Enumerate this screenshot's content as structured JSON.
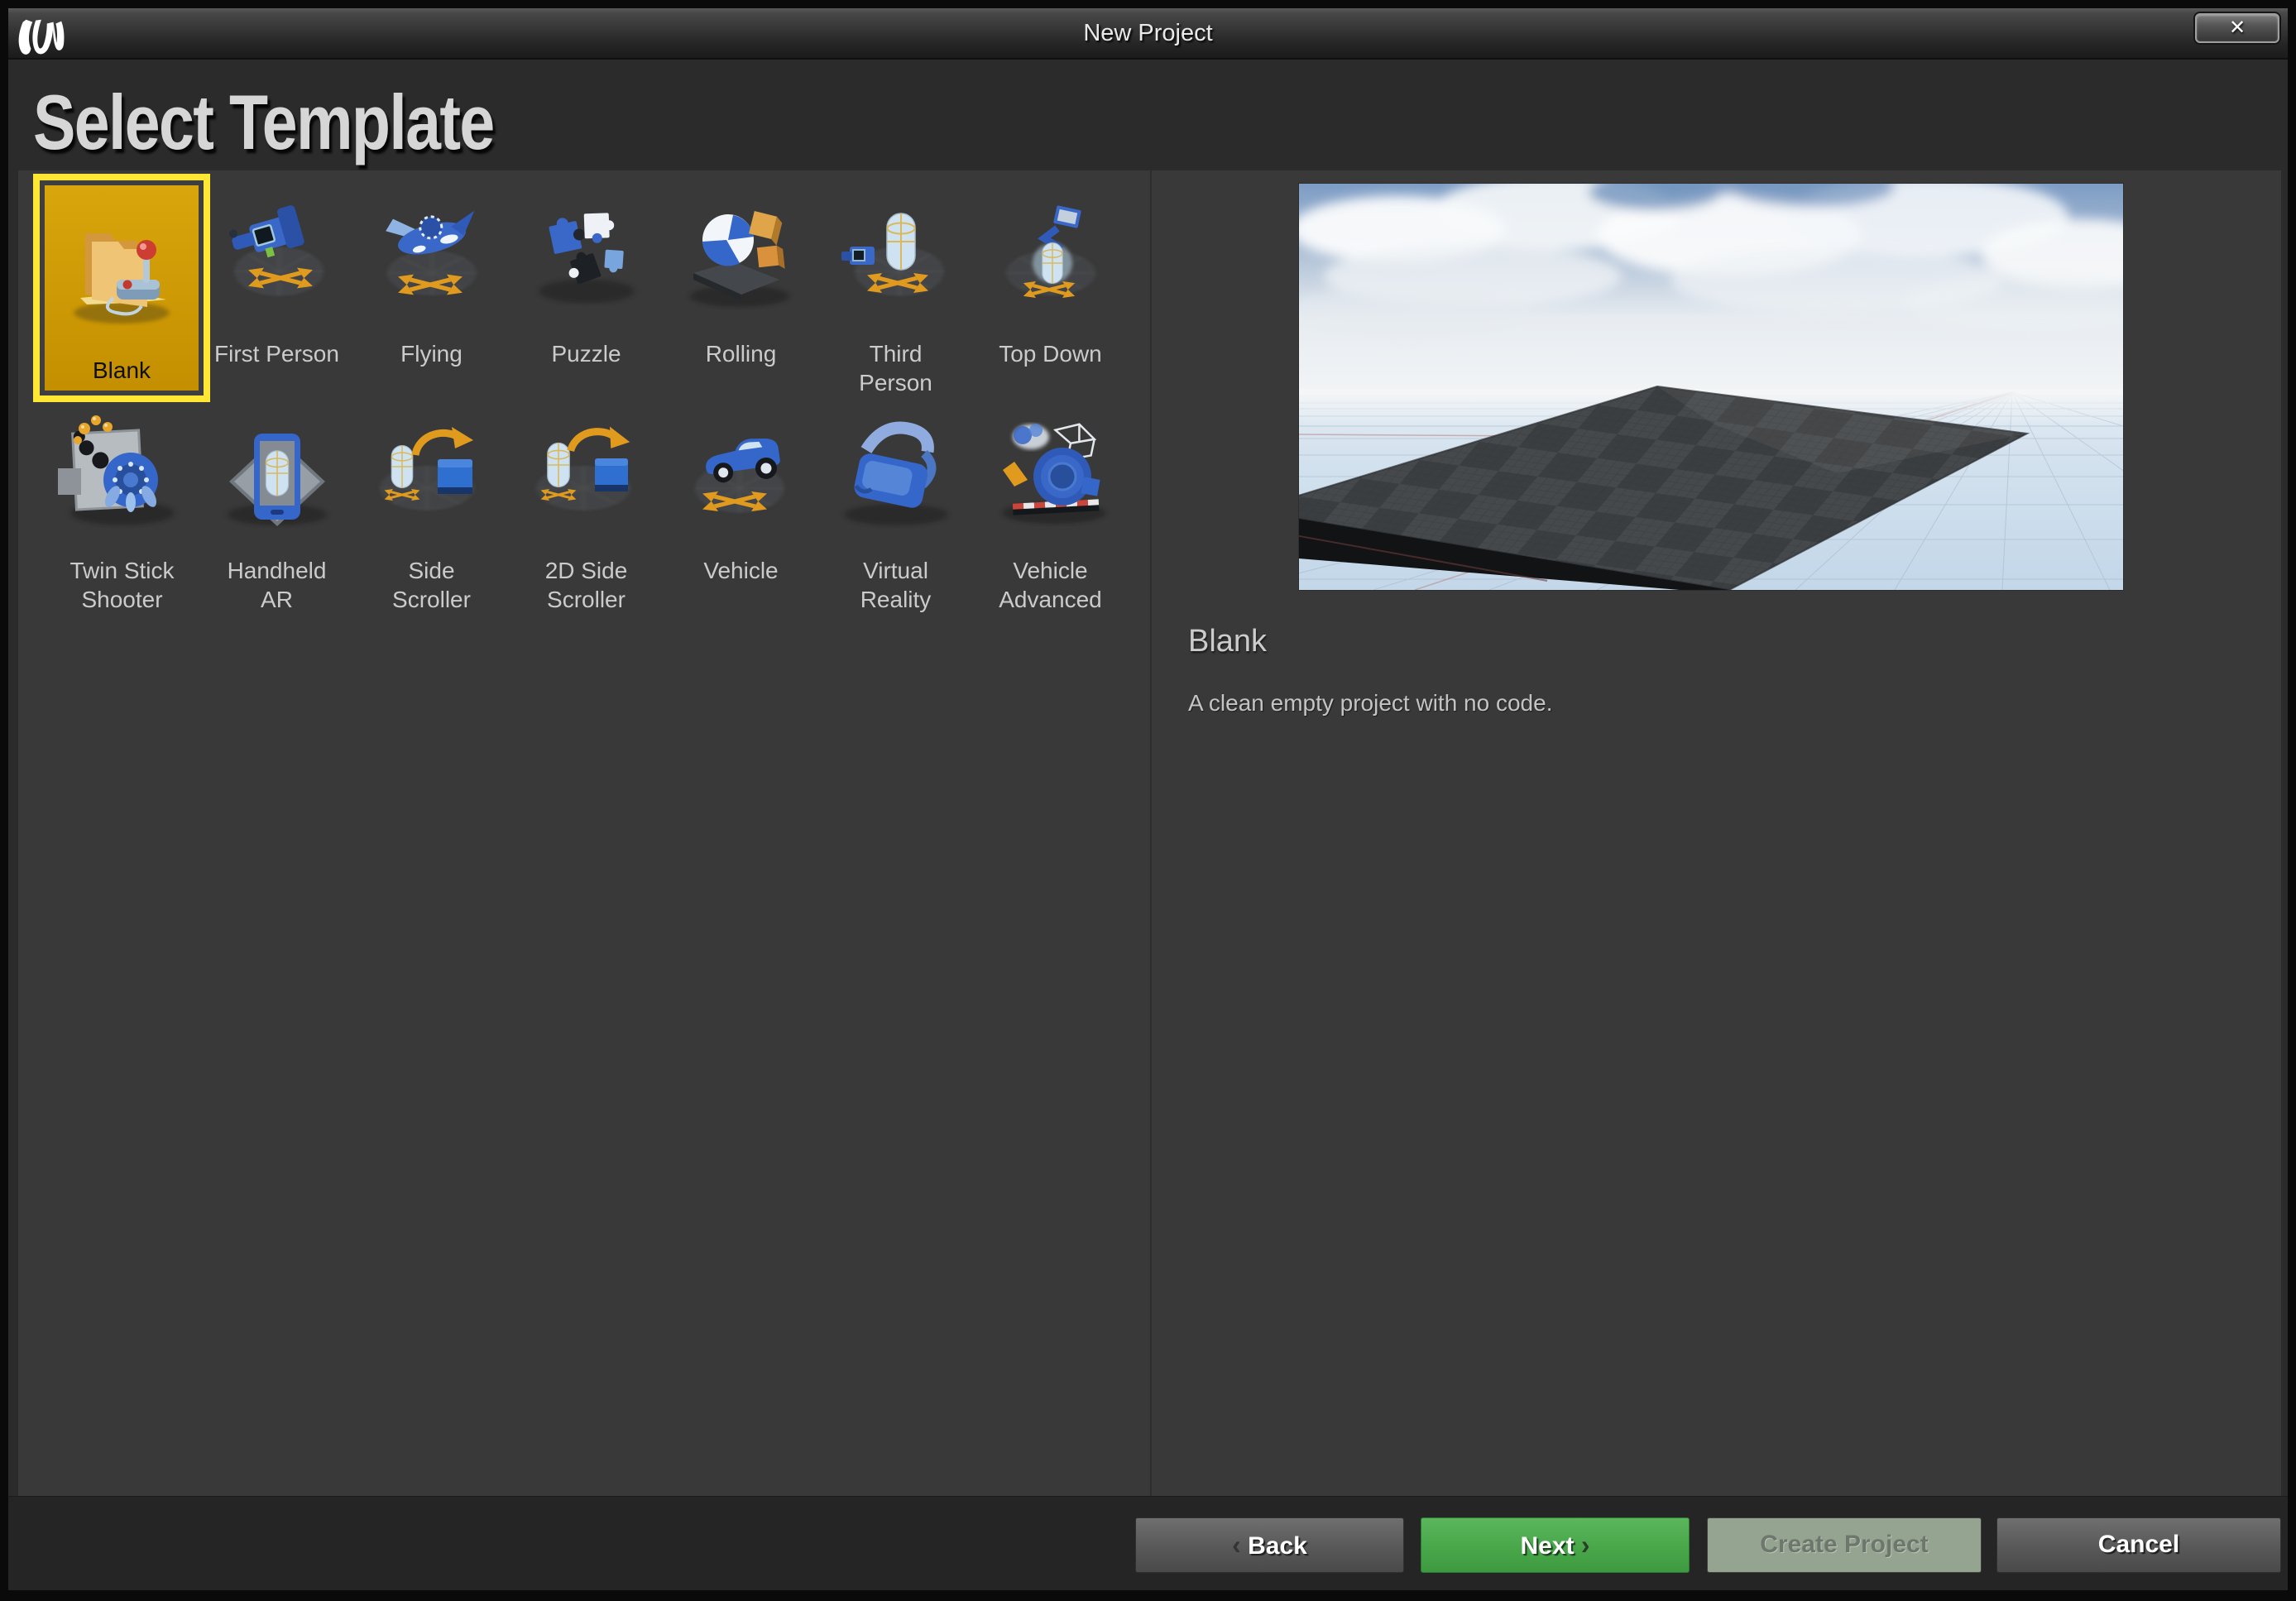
{
  "window": {
    "title": "New Project",
    "close_glyph": "✕",
    "logo": "unreal-engine-logo"
  },
  "header": {
    "title": "Select Template"
  },
  "templates": {
    "tiles": [
      {
        "label": "Blank",
        "icon": "blank-project-icon",
        "selected": true
      },
      {
        "label": "First Person",
        "icon": "first-person-icon",
        "selected": false
      },
      {
        "label": "Flying",
        "icon": "flying-icon",
        "selected": false
      },
      {
        "label": "Puzzle",
        "icon": "puzzle-icon",
        "selected": false
      },
      {
        "label": "Rolling",
        "icon": "rolling-icon",
        "selected": false
      },
      {
        "label": "Third Person",
        "icon": "third-person-icon",
        "selected": false
      },
      {
        "label": "Top Down",
        "icon": "top-down-icon",
        "selected": false
      },
      {
        "label": "Twin Stick Shooter",
        "icon": "twin-stick-shooter-icon",
        "selected": false
      },
      {
        "label": "Handheld AR",
        "icon": "handheld-ar-icon",
        "selected": false
      },
      {
        "label": "Side Scroller",
        "icon": "side-scroller-icon",
        "selected": false
      },
      {
        "label": "2D Side Scroller",
        "icon": "2d-side-scroller-icon",
        "selected": false
      },
      {
        "label": "Vehicle",
        "icon": "vehicle-icon",
        "selected": false
      },
      {
        "label": "Virtual Reality",
        "icon": "virtual-reality-icon",
        "selected": false
      },
      {
        "label": "Vehicle Advanced",
        "icon": "vehicle-advanced-icon",
        "selected": false
      }
    ]
  },
  "details": {
    "title": "Blank",
    "description": "A clean empty project with no code.",
    "preview": "blank-level-preview"
  },
  "footer": {
    "back": {
      "label": "Back",
      "chevron": "‹"
    },
    "next": {
      "label": "Next",
      "chevron": "›"
    },
    "create": {
      "label": "Create Project",
      "enabled": false
    },
    "cancel": {
      "label": "Cancel"
    }
  },
  "colors": {
    "selection_yellow": "#ffe733",
    "selection_gold": "#cf9b04",
    "primary_green": "#49a74a",
    "disabled_green": "#95a391",
    "panel_gray": "#393939"
  }
}
